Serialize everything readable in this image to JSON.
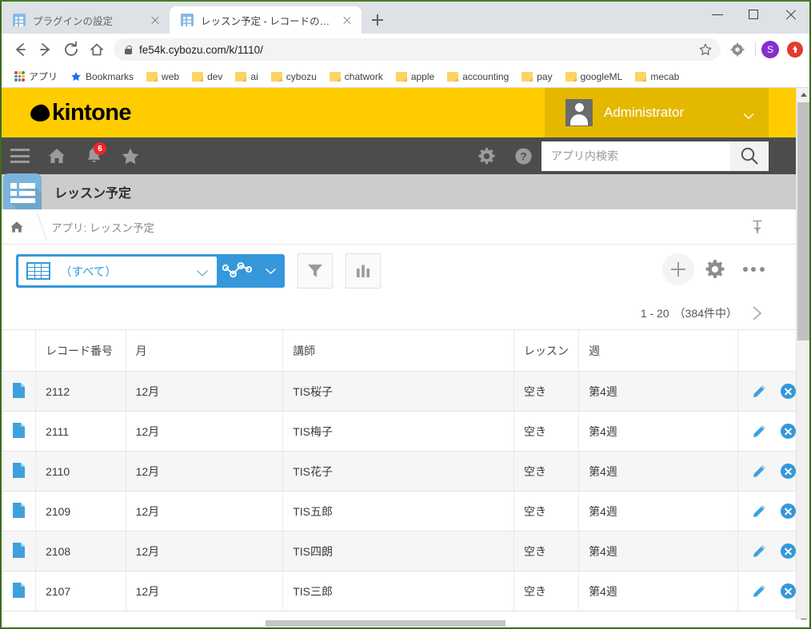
{
  "browser": {
    "tabs": [
      {
        "title": "プラグインの設定",
        "active": false
      },
      {
        "title": "レッスン予定 - レコードの一覧",
        "active": true
      }
    ],
    "new_tab_label": "+",
    "url": "fe54k.cybozu.com/k/1110/",
    "profile_initial": "S",
    "bookmarks": [
      {
        "label": "アプリ",
        "type": "apps"
      },
      {
        "label": "Bookmarks",
        "type": "star"
      },
      {
        "label": "web",
        "type": "folder"
      },
      {
        "label": "dev",
        "type": "folder"
      },
      {
        "label": "ai",
        "type": "folder"
      },
      {
        "label": "cybozu",
        "type": "folder"
      },
      {
        "label": "chatwork",
        "type": "folder"
      },
      {
        "label": "apple",
        "type": "folder"
      },
      {
        "label": "accounting",
        "type": "folder"
      },
      {
        "label": "pay",
        "type": "folder"
      },
      {
        "label": "googleML",
        "type": "folder"
      },
      {
        "label": "mecab",
        "type": "folder"
      }
    ]
  },
  "kintone": {
    "brand": "kintone",
    "brand_color": "#ffcc00",
    "accent_color": "#3498db",
    "user_name": "Administrator",
    "notification_count": "6",
    "search_placeholder": "アプリ内検索",
    "app_title": "レッスン予定",
    "breadcrumb": "アプリ: レッスン予定",
    "toolbar": {
      "view_name": "（すべて）",
      "filter_label": "絞り込む",
      "chart_label": "グラフ",
      "add_label": "レコードを追加する",
      "settings_label": "アプリの設定",
      "more_label": "オプション"
    },
    "pager": {
      "range": "1 - 20",
      "total": "（384件中）"
    },
    "table": {
      "columns": [
        "",
        "レコード番号",
        "月",
        "講師",
        "レッスン",
        "週",
        ""
      ],
      "rows": [
        {
          "record_no": "2112",
          "month": "12月",
          "teacher": "TIS桜子",
          "lesson": "空き",
          "week": "第4週"
        },
        {
          "record_no": "2111",
          "month": "12月",
          "teacher": "TIS梅子",
          "lesson": "空き",
          "week": "第4週"
        },
        {
          "record_no": "2110",
          "month": "12月",
          "teacher": "TIS花子",
          "lesson": "空き",
          "week": "第4週"
        },
        {
          "record_no": "2109",
          "month": "12月",
          "teacher": "TIS五郎",
          "lesson": "空き",
          "week": "第4週"
        },
        {
          "record_no": "2108",
          "month": "12月",
          "teacher": "TIS四朗",
          "lesson": "空き",
          "week": "第4週"
        },
        {
          "record_no": "2107",
          "month": "12月",
          "teacher": "TIS三郎",
          "lesson": "空き",
          "week": "第4週"
        }
      ]
    }
  }
}
